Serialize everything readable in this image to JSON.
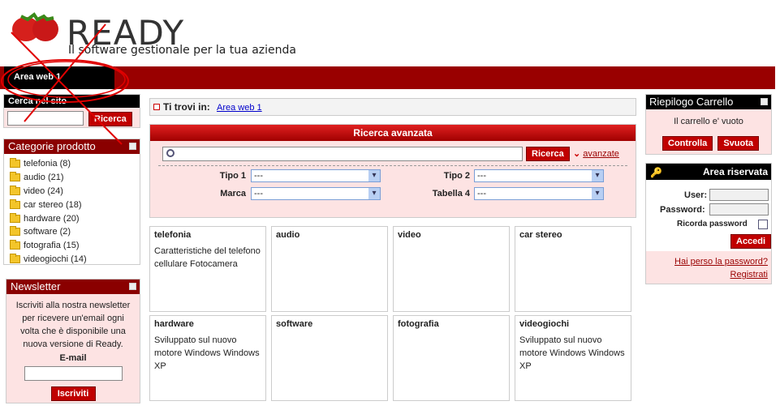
{
  "header": {
    "logo_text": "READY",
    "tagline": "Il software gestionale per la tua azienda",
    "nav_label": "Area web 1"
  },
  "search": {
    "title": "Cerca nel sito",
    "button": "Ricerca",
    "value": ""
  },
  "categories": {
    "title": "Categorie prodotto",
    "items": [
      "telefonia (8)",
      "audio (21)",
      "video (24)",
      "car stereo (18)",
      "hardware (20)",
      "software (2)",
      "fotografia (15)",
      "videogiochi (14)"
    ]
  },
  "newsletter": {
    "title": "Newsletter",
    "text": "Iscriviti alla nostra newsletter per ricevere un'email ogni volta che è disponibile una nuova versione di Ready.",
    "email_label": "E-mail",
    "button": "Iscriviti"
  },
  "breadcrumb": {
    "label": "Ti trovi in:",
    "link": "Area web 1"
  },
  "advanced": {
    "title": "Ricerca avanzata",
    "button": "Ricerca",
    "more_link": "avanzate",
    "filters": {
      "tipo1_label": "Tipo 1",
      "tipo1_value": "---",
      "tipo2_label": "Tipo 2",
      "tipo2_value": "---",
      "marca_label": "Marca",
      "marca_value": "---",
      "tabella4_label": "Tabella 4",
      "tabella4_value": "---"
    }
  },
  "products": [
    {
      "title": "telefonia",
      "desc": "Caratteristiche del telefono cellulare Fotocamera"
    },
    {
      "title": "audio",
      "desc": ""
    },
    {
      "title": "video",
      "desc": ""
    },
    {
      "title": "car stereo",
      "desc": ""
    },
    {
      "title": "hardware",
      "desc": "Sviluppato sul nuovo motore Windows Windows XP"
    },
    {
      "title": "software",
      "desc": ""
    },
    {
      "title": "fotografia",
      "desc": ""
    },
    {
      "title": "videogiochi",
      "desc": "Sviluppato sul nuovo motore Windows Windows XP"
    }
  ],
  "cart": {
    "title": "Riepilogo Carrello",
    "empty_text": "Il carrello e' vuoto",
    "checkout_button": "Controlla",
    "empty_button": "Svuota"
  },
  "login": {
    "title": "Area riservata",
    "user_label": "User:",
    "password_label": "Password:",
    "remember_label": "Ricorda password",
    "button": "Accedi",
    "forgot_link": "Hai perso la password?",
    "register_link": "Registrati"
  },
  "colors": {
    "brand_red": "#990000",
    "button_red": "#c00000",
    "panel_pink": "#fde3e3"
  }
}
